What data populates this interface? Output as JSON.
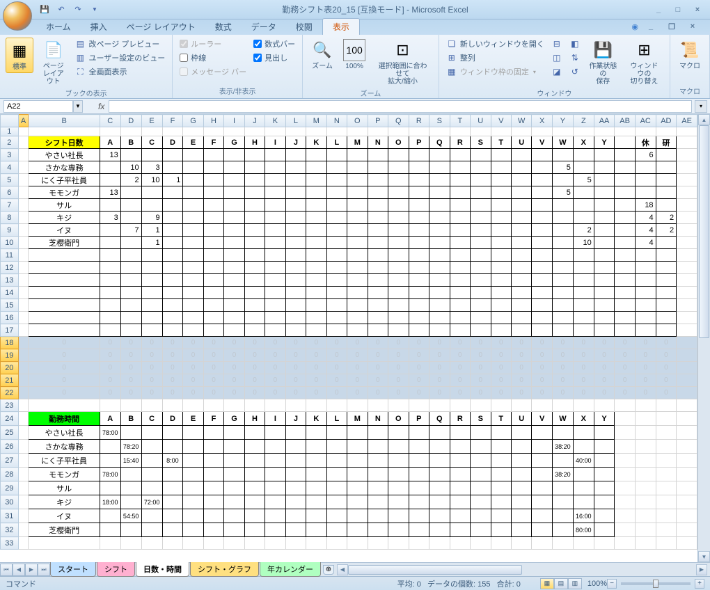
{
  "title": "勤務シフト表20_15 [互換モード] - Microsoft Excel",
  "tabs": [
    "ホーム",
    "挿入",
    "ページ レイアウト",
    "数式",
    "データ",
    "校閲",
    "表示"
  ],
  "active_tab": 6,
  "ribbon": {
    "g1": {
      "label": "ブックの表示",
      "standard": "標準",
      "page": "ページ\nレイアウト",
      "items": [
        "改ページ プレビュー",
        "ユーザー設定のビュー",
        "全画面表示"
      ]
    },
    "g2": {
      "label": "表示/非表示",
      "ruler": "ルーラー",
      "formula": "数式バー",
      "gridlines": "枠線",
      "headings": "見出し",
      "msgbar": "メッセージ バー"
    },
    "g3": {
      "label": "ズーム",
      "zoom": "ズーム",
      "pct": "100%",
      "sel": "選択範囲に合わせて\n拡大/縮小"
    },
    "g4": {
      "label": "ウィンドウ",
      "new": "新しいウィンドウを開く",
      "arrange": "整列",
      "freeze": "ウィンドウ枠の固定",
      "save": "作業状態の\n保存",
      "switch": "ウィンドウの\n切り替え"
    },
    "g5": {
      "label": "マクロ",
      "macro": "マクロ"
    }
  },
  "name_box": "A22",
  "col_headers": [
    "A",
    "B",
    "C",
    "D",
    "E",
    "F",
    "G",
    "H",
    "I",
    "J",
    "K",
    "L",
    "M",
    "N",
    "O",
    "P",
    "Q",
    "R",
    "S",
    "T",
    "U",
    "V",
    "W",
    "X",
    "Y",
    "Z",
    "AA",
    "AB",
    "AC",
    "AD",
    "AE"
  ],
  "row_headers": [
    1,
    2,
    3,
    4,
    5,
    6,
    7,
    8,
    9,
    10,
    11,
    12,
    13,
    14,
    15,
    16,
    17,
    18,
    19,
    20,
    21,
    22,
    23,
    24,
    25,
    26,
    27,
    28,
    29,
    30,
    31,
    32,
    33
  ],
  "table1": {
    "header": "シフト日数",
    "cols": [
      "A",
      "B",
      "C",
      "D",
      "E",
      "F",
      "G",
      "H",
      "I",
      "J",
      "K",
      "L",
      "M",
      "N",
      "O",
      "P",
      "Q",
      "R",
      "S",
      "T",
      "U",
      "V",
      "W",
      "X",
      "Y",
      "",
      "休",
      "研"
    ],
    "rows": [
      {
        "name": "やさい社長",
        "d": {
          "A": "13"
        },
        "ex": {
          "休": "6"
        }
      },
      {
        "name": "さかな専務",
        "d": {
          "B": "10",
          "C": "3",
          "W": "5"
        }
      },
      {
        "name": "にく子平社員",
        "d": {
          "B": "2",
          "C": "10",
          "D": "1",
          "X": "5"
        }
      },
      {
        "name": "モモンガ",
        "d": {
          "A": "13",
          "W": "5"
        }
      },
      {
        "name": "サル",
        "ex": {
          "休": "18"
        }
      },
      {
        "name": "キジ",
        "d": {
          "A": "3",
          "C": "9"
        },
        "ex": {
          "休": "4",
          "研": "2"
        }
      },
      {
        "name": "イヌ",
        "d": {
          "B": "7",
          "C": "1",
          "X": "2"
        },
        "ex": {
          "休": "4",
          "研": "2"
        }
      },
      {
        "name": "芝櫻衛門",
        "d": {
          "C": "1",
          "X": "10"
        },
        "ex": {
          "休": "4"
        }
      }
    ]
  },
  "table2": {
    "header": "勤務時間",
    "cols": [
      "A",
      "B",
      "C",
      "D",
      "E",
      "F",
      "G",
      "H",
      "I",
      "J",
      "K",
      "L",
      "M",
      "N",
      "O",
      "P",
      "Q",
      "R",
      "S",
      "T",
      "U",
      "V",
      "W",
      "X",
      "Y"
    ],
    "rows": [
      {
        "name": "やさい社長",
        "d": {
          "A": "78:00"
        }
      },
      {
        "name": "さかな専務",
        "d": {
          "B": "78:20",
          "W": "38:20"
        }
      },
      {
        "name": "にく子平社員",
        "d": {
          "B": "15:40",
          "D": "8:00",
          "X": "40:00"
        }
      },
      {
        "name": "モモンガ",
        "d": {
          "A": "78:00",
          "W": "38:20"
        }
      },
      {
        "name": "サル",
        "d": {}
      },
      {
        "name": "キジ",
        "d": {
          "A": "18:00",
          "C": "72:00"
        }
      },
      {
        "name": "イヌ",
        "d": {
          "B": "54:50",
          "X": "16:00"
        }
      },
      {
        "name": "芝櫻衛門",
        "d": {
          "X": "80:00"
        }
      }
    ]
  },
  "sheets": [
    "スタート",
    "シフト",
    "日数・時間",
    "シフト・グラフ",
    "年カレンダー"
  ],
  "active_sheet": 2,
  "status": {
    "mode": "コマンド",
    "avg": "平均: 0",
    "count": "データの個数: 155",
    "sum": "合計: 0",
    "zoom": "100%"
  }
}
